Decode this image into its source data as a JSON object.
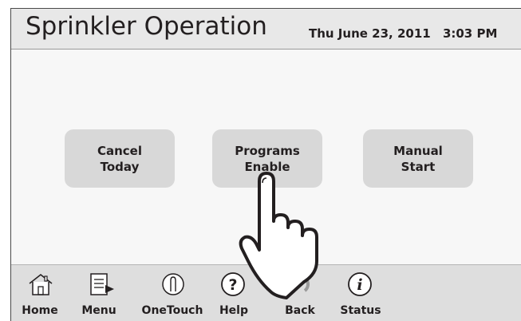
{
  "header": {
    "title": "Sprinkler Operation",
    "date": "Thu June 23, 2011",
    "time": "3:03 PM"
  },
  "buttons": [
    {
      "line1": "Cancel",
      "line2": "Today"
    },
    {
      "line1": "Programs",
      "line2": "Enable"
    },
    {
      "line1": "Manual",
      "line2": "Start"
    }
  ],
  "nav": [
    {
      "label": "Home",
      "icon": "home-icon"
    },
    {
      "label": "Menu",
      "icon": "menu-icon"
    },
    {
      "label": "OneTouch",
      "icon": "onetouch-icon"
    },
    {
      "label": "Help",
      "icon": "help-icon"
    },
    {
      "label": "Back",
      "icon": "back-icon"
    },
    {
      "label": "Status",
      "icon": "status-icon"
    }
  ],
  "colors": {
    "header_bg": "#e8e8e8",
    "button_bg": "#d8d8d8",
    "footer_bg": "#dedede",
    "text": "#231f20"
  }
}
